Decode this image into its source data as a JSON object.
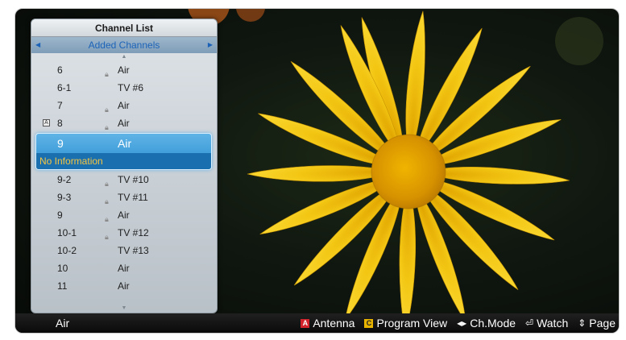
{
  "panel": {
    "title": "Channel List",
    "subtitle": "Added Channels"
  },
  "channels": [
    {
      "num": "6",
      "locked": true,
      "name": "Air",
      "badge": false
    },
    {
      "num": "6-1",
      "locked": false,
      "name": "TV #6",
      "badge": false
    },
    {
      "num": "7",
      "locked": true,
      "name": "Air",
      "badge": false
    },
    {
      "num": "8",
      "locked": true,
      "name": "Air",
      "badge": true
    }
  ],
  "selected": {
    "num": "9",
    "name": "Air",
    "info": "No Information"
  },
  "channels_after": [
    {
      "num": "9-2",
      "locked": true,
      "name": "TV #10"
    },
    {
      "num": "9-3",
      "locked": true,
      "name": "TV #11"
    },
    {
      "num": "9",
      "locked": true,
      "name": "Air"
    },
    {
      "num": "10-1",
      "locked": true,
      "name": "TV #12"
    },
    {
      "num": "10-2",
      "locked": false,
      "name": "TV #13"
    },
    {
      "num": "10",
      "locked": false,
      "name": "Air"
    },
    {
      "num": "11",
      "locked": false,
      "name": "Air"
    }
  ],
  "bottom_bar": {
    "source": "Air",
    "antenna_key": "A",
    "antenna": "Antenna",
    "program_key": "C",
    "program_view": "Program View",
    "ch_mode": "Ch.Mode",
    "watch": "Watch",
    "page": "Page"
  },
  "colors": {
    "accent_blue": "#2a8fd0",
    "info_yellow": "#f4c542",
    "subtitle_blue": "#1c63b8",
    "key_red": "#d4232b",
    "key_yellow": "#e8b400"
  },
  "icons": {
    "lock": "lock-icon",
    "left_right": "left-right-arrows-icon",
    "watch": "enter-icon",
    "page": "up-down-arrows-icon"
  }
}
